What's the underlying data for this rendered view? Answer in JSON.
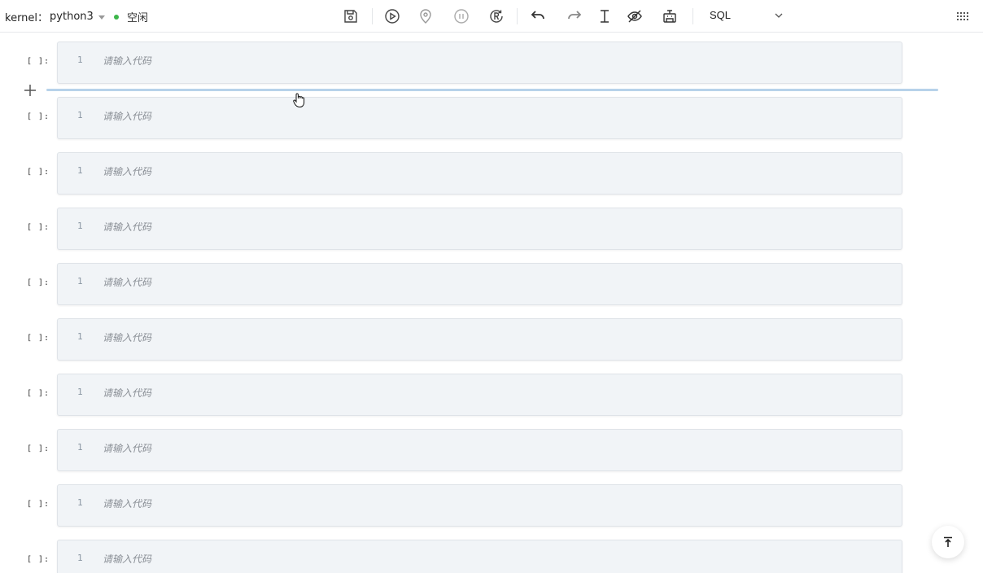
{
  "toolbar": {
    "kernel_label": "kernel：",
    "kernel_name": "python3",
    "status": "空闲",
    "status_color": "#3cb64a",
    "language": "SQL",
    "icons": [
      "save-icon",
      "run-icon",
      "location-icon",
      "pause-icon",
      "restart-icon",
      "undo-icon",
      "redo-icon",
      "text-cursor-icon",
      "hide-icon",
      "robot-icon",
      "chevron-down-icon",
      "grid-menu-icon"
    ]
  },
  "cells": [
    {
      "prompt": "[ ]:",
      "line": "1",
      "placeholder": "请输入代码"
    },
    {
      "prompt": "[ ]:",
      "line": "1",
      "placeholder": "请输入代码"
    },
    {
      "prompt": "[ ]:",
      "line": "1",
      "placeholder": "请输入代码"
    },
    {
      "prompt": "[ ]:",
      "line": "1",
      "placeholder": "请输入代码"
    },
    {
      "prompt": "[ ]:",
      "line": "1",
      "placeholder": "请输入代码"
    },
    {
      "prompt": "[ ]:",
      "line": "1",
      "placeholder": "请输入代码"
    },
    {
      "prompt": "[ ]:",
      "line": "1",
      "placeholder": "请输入代码"
    },
    {
      "prompt": "[ ]:",
      "line": "1",
      "placeholder": "请输入代码"
    },
    {
      "prompt": "[ ]:",
      "line": "1",
      "placeholder": "请输入代码"
    },
    {
      "prompt": "[ ]:",
      "line": "1",
      "placeholder": "请输入代码"
    }
  ],
  "colors": {
    "cell_bg": "#f1f4f7",
    "insert_line": "#b7d2ea"
  }
}
